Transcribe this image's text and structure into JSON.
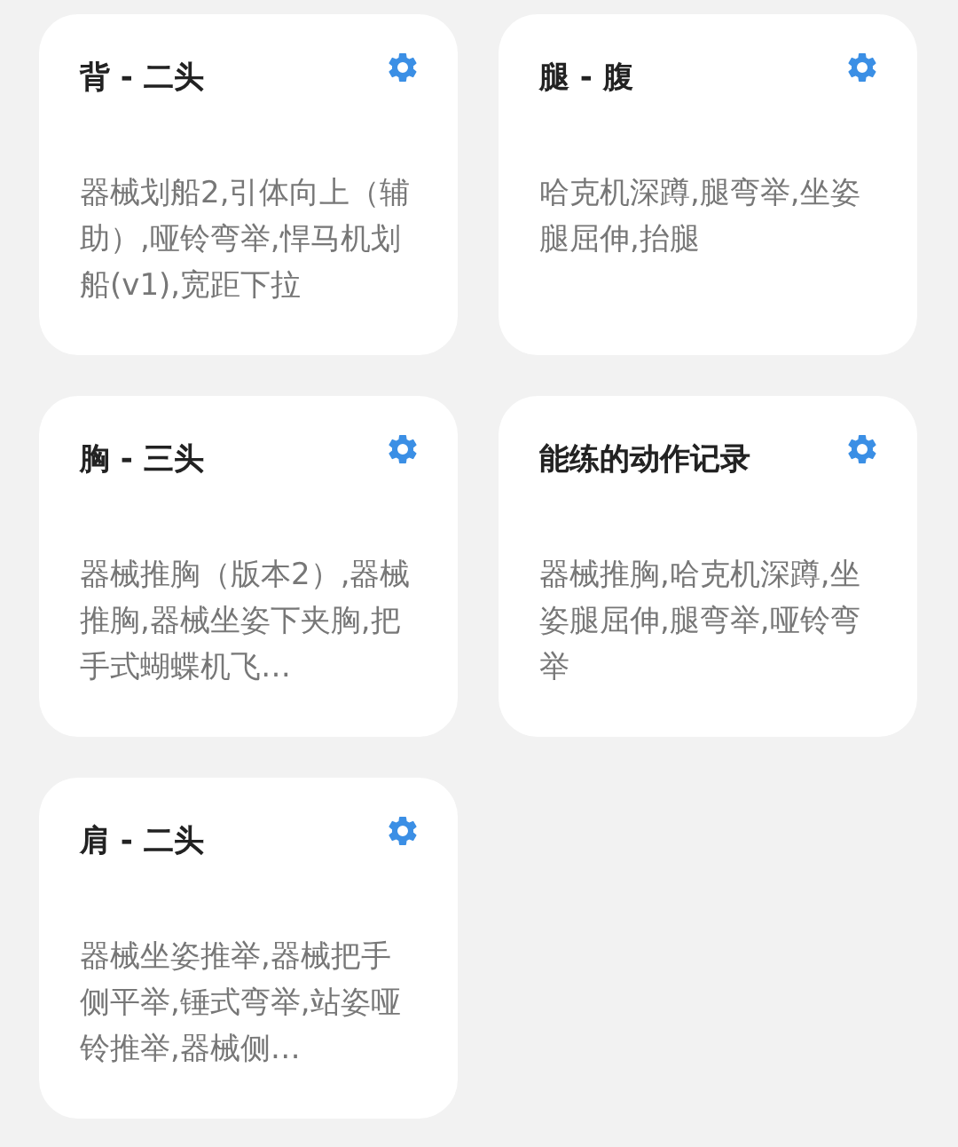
{
  "cards": [
    {
      "title": "背 - 二头",
      "exercises": "器械划船2,引体向上（辅助）,哑铃弯举,悍马机划船(v1),宽距下拉"
    },
    {
      "title": "腿 - 腹",
      "exercises": "哈克机深蹲,腿弯举,坐姿腿屈伸,抬腿"
    },
    {
      "title": "胸 - 三头",
      "exercises": "器械推胸（版本2）,器械推胸,器械坐姿下夹胸,把手式蝴蝶机飞…"
    },
    {
      "title": "能练的动作记录",
      "exercises": "器械推胸,哈克机深蹲,坐姿腿屈伸,腿弯举,哑铃弯举"
    },
    {
      "title": "肩 - 二头",
      "exercises": "器械坐姿推举,器械把手侧平举,锤式弯举,站姿哑铃推举,器械侧…"
    }
  ]
}
